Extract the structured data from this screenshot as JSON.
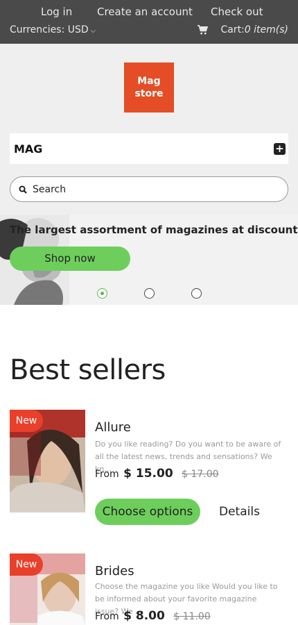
{
  "topbar": {
    "login": "Log in",
    "create_account": "Create an account",
    "checkout": "Check out",
    "currencies": "Currencies: USD",
    "cart_label": "Cart:",
    "cart_count": "0 item(s)"
  },
  "logo": {
    "line1": "Mag",
    "line2": "store"
  },
  "menu": {
    "title": "MAG"
  },
  "search": {
    "placeholder": "Search"
  },
  "slider": {
    "title": "The largest assortment of magazines at discount prices",
    "button": "Shop now",
    "active_dot": 0
  },
  "best_sellers": {
    "title": "Best sellers",
    "products": [
      {
        "badge": "New",
        "name": "Allure",
        "description": "Do you like reading? Do you want to be aware of all the latest news, trends and sensations? We kn...",
        "from": "From",
        "price": "$ 15.00",
        "old_price": "$ 17.00",
        "choose": "Choose options",
        "details": "Details"
      },
      {
        "badge": "New",
        "name": "Brides",
        "description": "Choose the magazine you like Would you like to be informed about your favorite magazine issue? We ...",
        "from": "From",
        "price": "$ 8.00",
        "old_price": "$ 11.00"
      }
    ]
  },
  "colors": {
    "topbar_bg": "#4a4a4a",
    "logo_bg": "#e44d26",
    "accent_green": "#6dce5c",
    "badge_red": "#e8402b"
  }
}
